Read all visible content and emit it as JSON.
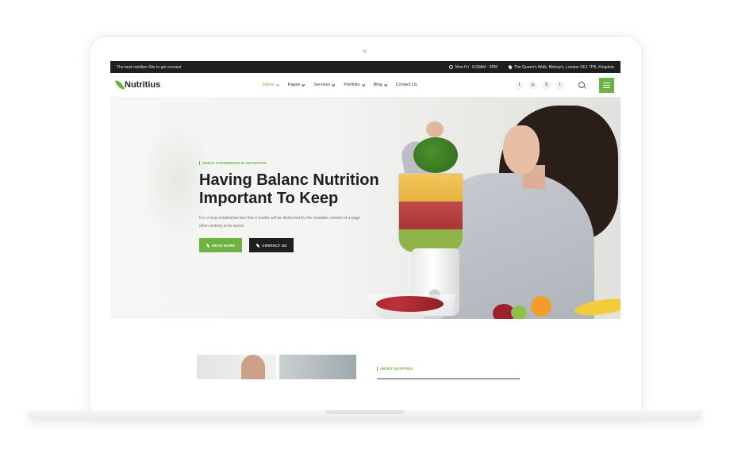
{
  "topbar": {
    "tagline": "The best nutrition Site to get connect",
    "hours": "Mon-Fri : 9:00AM - 5PM",
    "address": "The Queen's Walk, Bishop's, London SE1 7PB, Kingdom"
  },
  "brand": {
    "name": "Nutritius",
    "accent_color": "#6cb33f",
    "dark_color": "#1e1e1e"
  },
  "nav": {
    "items": [
      {
        "label": "Home",
        "active": true,
        "has_dropdown": true
      },
      {
        "label": "Pages",
        "active": false,
        "has_dropdown": true
      },
      {
        "label": "Services",
        "active": false,
        "has_dropdown": true
      },
      {
        "label": "Portfolio",
        "active": false,
        "has_dropdown": true
      },
      {
        "label": "Blog",
        "active": false,
        "has_dropdown": true
      },
      {
        "label": "Contact Us",
        "active": false,
        "has_dropdown": false
      }
    ],
    "socials": [
      {
        "icon": "facebook-icon",
        "glyph": "f"
      },
      {
        "icon": "instagram-icon",
        "glyph": "◎"
      },
      {
        "icon": "skype-icon",
        "glyph": "S"
      },
      {
        "icon": "twitter-icon",
        "glyph": "t"
      }
    ]
  },
  "hero": {
    "eyebrow": "GREAT EXPERIENCE IN NUTRITION",
    "title": "Having Balanc Nutrition Important To Keep",
    "description": "It is a long established fact that a reader will be distracted by the readable content of a page when looking at its layout.",
    "primary_button": "READ MORE",
    "secondary_button": "CONTACT US"
  },
  "about": {
    "eyebrow": "ABOUT NUTRITIUS"
  }
}
